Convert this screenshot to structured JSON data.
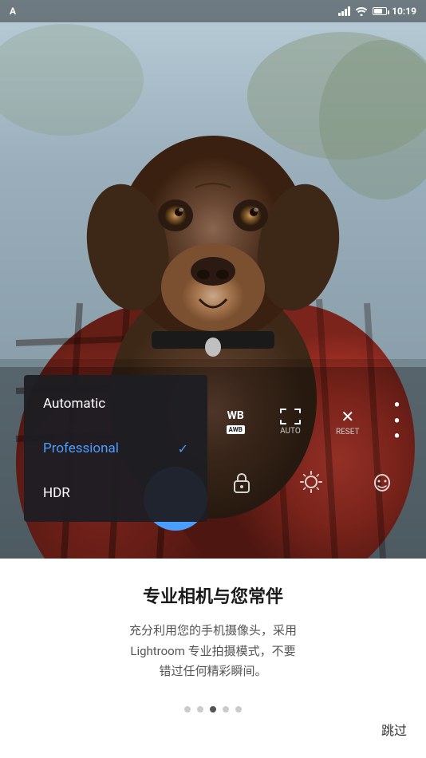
{
  "statusBar": {
    "carrier": "A",
    "time": "10:19",
    "batteryLevel": "65"
  },
  "dropdown": {
    "items": [
      {
        "id": "automatic",
        "label": "Automatic",
        "active": false
      },
      {
        "id": "professional",
        "label": "Professional",
        "active": true
      },
      {
        "id": "hdr",
        "label": "HDR",
        "active": false
      }
    ]
  },
  "cameraControls": {
    "wb": {
      "label": "WB",
      "badge": "AWB"
    },
    "auto": {
      "label": "AUTO"
    },
    "reset": {
      "label": "RESET"
    }
  },
  "bottomSection": {
    "title": "专业相机与您常伴",
    "description": "充分利用您的手机摄像头，采用\nLightroom 专业拍摄模式，不要\n错过任何精彩瞬间。",
    "skipLabel": "跳过",
    "dots": [
      {
        "active": false
      },
      {
        "active": false
      },
      {
        "active": true
      },
      {
        "active": false
      },
      {
        "active": false
      }
    ]
  },
  "icons": {
    "check": "✓",
    "close": "✕",
    "more": "⋮",
    "lock": "🔓",
    "exposure": "☀",
    "faceDetect": "◎"
  },
  "colors": {
    "accent": "#4a9eff",
    "activeText": "#4a9eff",
    "menuBg": "rgba(30,30,35,0.95)"
  }
}
